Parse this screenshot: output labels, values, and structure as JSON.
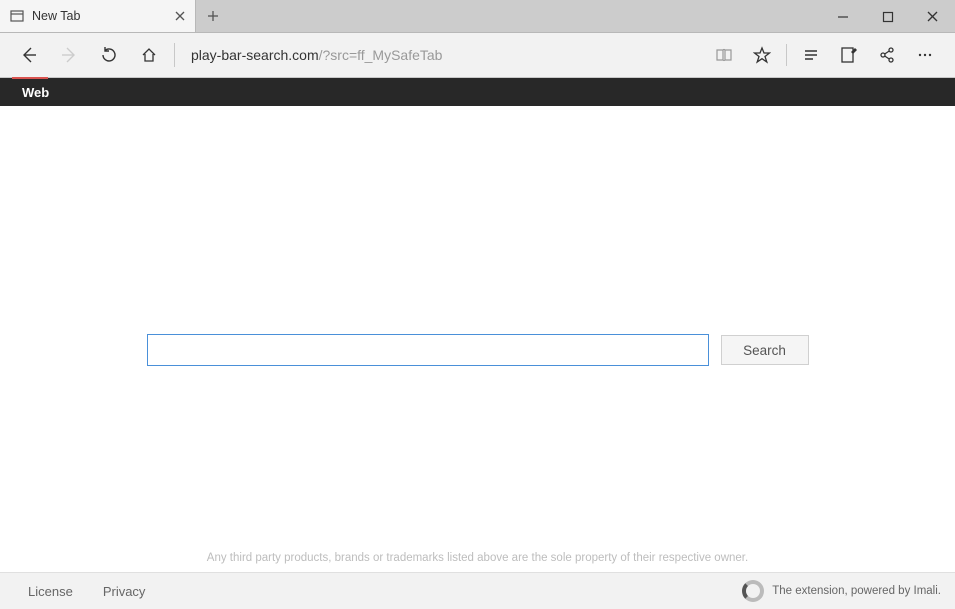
{
  "titlebar": {
    "tab_title": "New Tab"
  },
  "address": {
    "host": "play-bar-search.com",
    "path": "/?src=ff_MySafeTab"
  },
  "darkbar": {
    "tab_label": "Web"
  },
  "search": {
    "value": "",
    "button_label": "Search"
  },
  "disclaimer": "Any third party products, brands or trademarks listed above are the sole property of their respective owner.",
  "footer": {
    "license": "License",
    "privacy": "Privacy",
    "credit": "The extension, powered by Imali."
  }
}
